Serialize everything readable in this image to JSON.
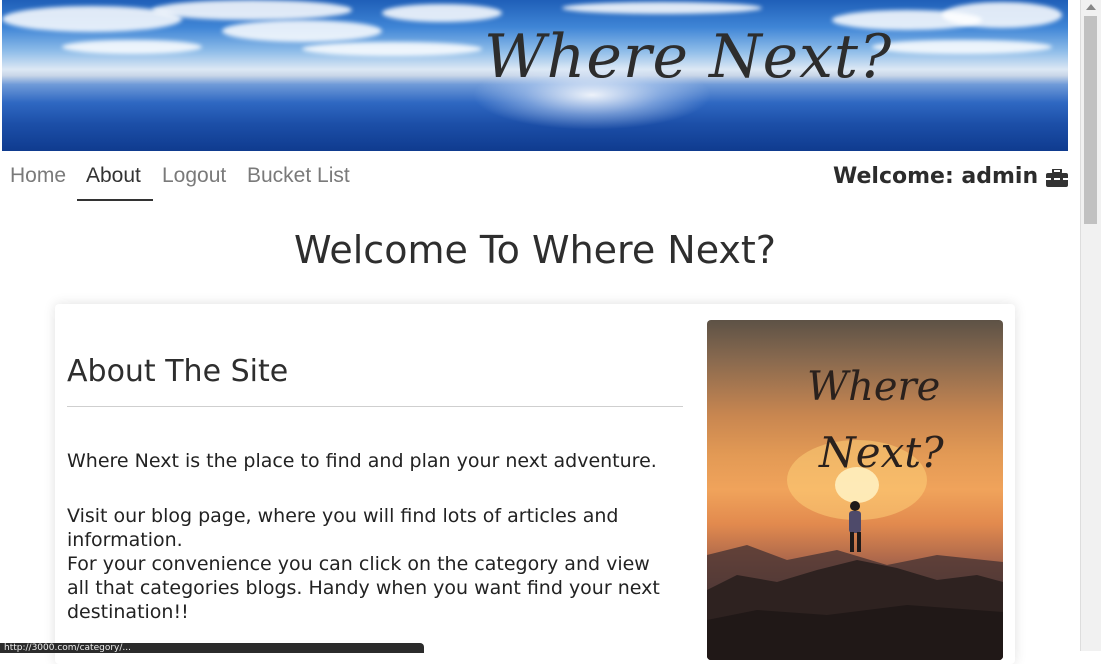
{
  "banner": {
    "title": "Where Next?"
  },
  "nav": {
    "items": [
      {
        "label": "Home"
      },
      {
        "label": "About"
      },
      {
        "label": "Logout"
      },
      {
        "label": "Bucket List"
      }
    ],
    "welcome": "Welcome: admin",
    "icon": "toolbox-icon"
  },
  "main": {
    "heading": "Welcome To Where Next?",
    "card": {
      "title": "About The Site",
      "p1": "Where Next is the place to find and plan your next adventure.",
      "p2": "Visit our blog page, where you will find lots of articles and information.",
      "p3": "For your convenience you can click on the category and view all that categories blogs. Handy when you want find your next destination!!",
      "poster_line1": "Where",
      "poster_line2": "Next?"
    }
  },
  "status": {
    "url": "http://3000.com/category/..."
  },
  "colors": {
    "nav_active": "#333333",
    "nav_inactive": "#7a7a7a"
  }
}
